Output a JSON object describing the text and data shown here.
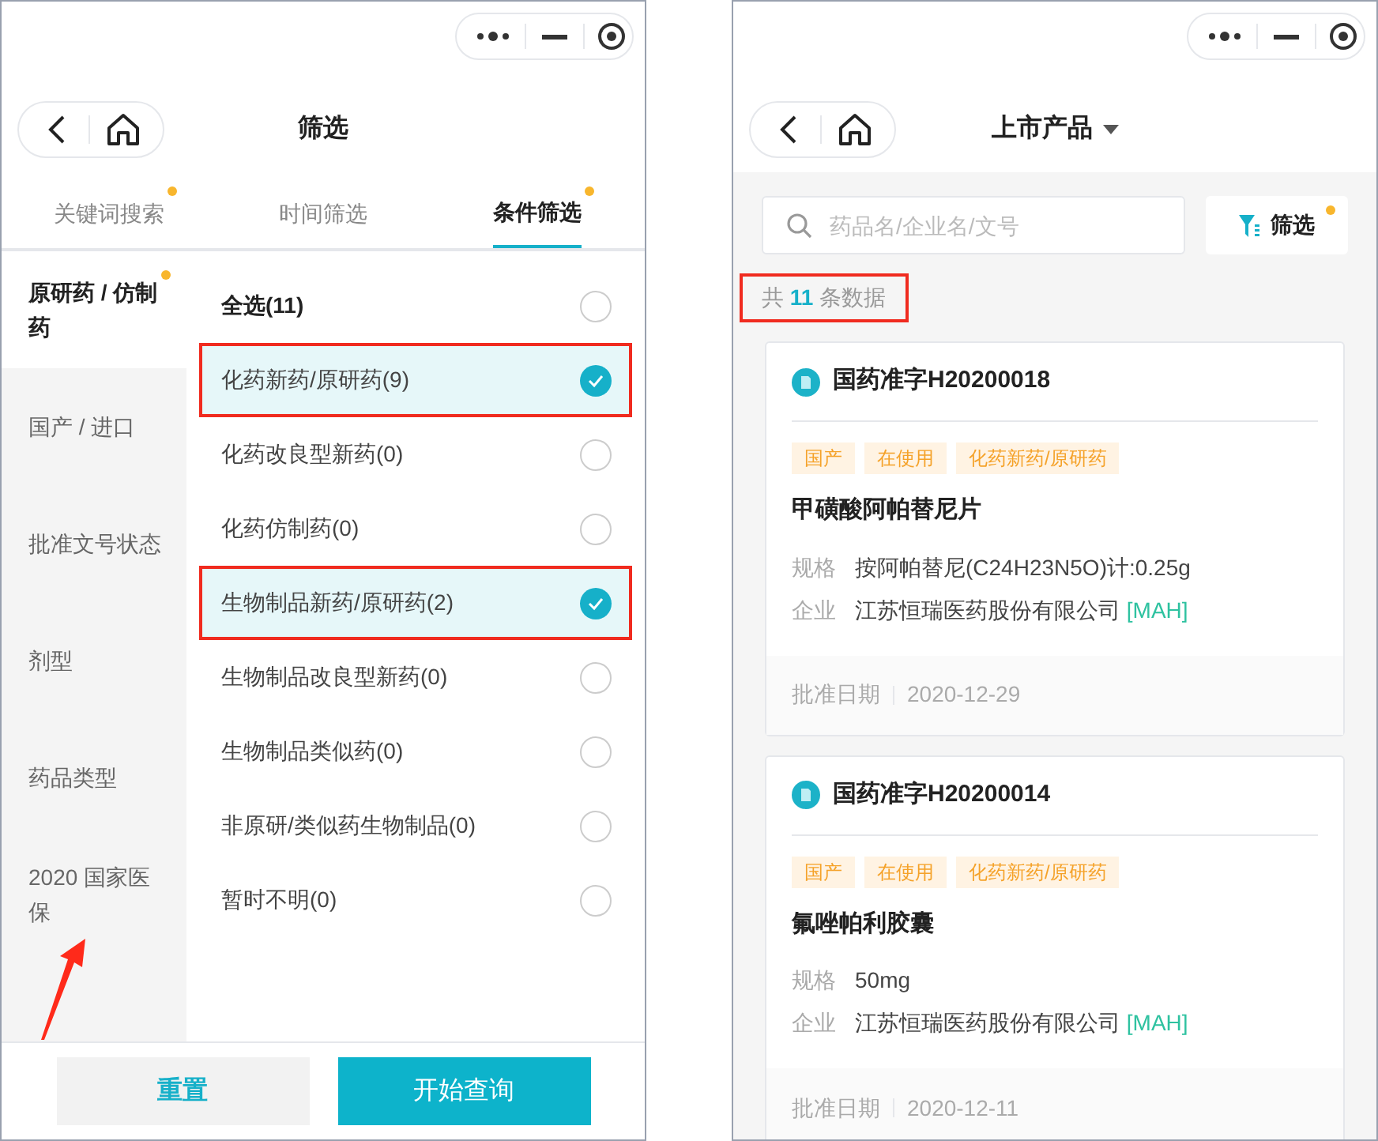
{
  "left_screen": {
    "title": "筛选",
    "tabs": [
      {
        "label": "关键词搜索",
        "selected": false,
        "dot": true
      },
      {
        "label": "时间筛选",
        "selected": false,
        "dot": false
      },
      {
        "label": "条件筛选",
        "selected": true,
        "dot": true
      }
    ],
    "sidebar": {
      "items": [
        {
          "label": "原研药 / 仿制药",
          "selected": true,
          "dot": true,
          "arrow": false
        },
        {
          "label": "国产 / 进口",
          "selected": false,
          "dot": false,
          "arrow": false
        },
        {
          "label": "批准文号状态",
          "selected": false,
          "dot": false,
          "arrow": false
        },
        {
          "label": "剂型",
          "selected": false,
          "dot": false,
          "arrow": false
        },
        {
          "label": "药品类型",
          "selected": false,
          "dot": false,
          "arrow": false
        },
        {
          "label": "2020 国家医保",
          "selected": false,
          "dot": false,
          "arrow": true
        }
      ]
    },
    "options": [
      {
        "label": "全选(11)",
        "kind": "all",
        "checked": false,
        "highlighted": false
      },
      {
        "label": "化药新药/原研药(9)",
        "kind": "option",
        "checked": true,
        "highlighted": true
      },
      {
        "label": "化药改良型新药(0)",
        "kind": "option",
        "checked": false,
        "highlighted": false
      },
      {
        "label": "化药仿制药(0)",
        "kind": "option",
        "checked": false,
        "highlighted": false
      },
      {
        "label": "生物制品新药/原研药(2)",
        "kind": "option",
        "checked": true,
        "highlighted": true
      },
      {
        "label": "生物制品改良型新药(0)",
        "kind": "option",
        "checked": false,
        "highlighted": false
      },
      {
        "label": "生物制品类似药(0)",
        "kind": "option",
        "checked": false,
        "highlighted": false
      },
      {
        "label": "非原研/类似药生物制品(0)",
        "kind": "option",
        "checked": false,
        "highlighted": false
      },
      {
        "label": "暂时不明(0)",
        "kind": "option",
        "checked": false,
        "highlighted": false
      }
    ],
    "buttons": [
      {
        "label": "重置",
        "kind": "secondary"
      },
      {
        "label": "开始查询",
        "kind": "primary"
      }
    ]
  },
  "right_screen": {
    "title": "上市产品",
    "search": {
      "placeholder": "药品名/企业名/文号"
    },
    "filter_button": {
      "label": "筛选",
      "dot": true
    },
    "count": {
      "prefix": "共",
      "number": "11",
      "suffix": "条数据",
      "highlighted": true
    },
    "cards": [
      {
        "approval_no": "国药准字H20200018",
        "tags": [
          "国产",
          "在使用",
          "化药新药/原研药"
        ],
        "name": "甲磺酸阿帕替尼片",
        "spec_label": "规格",
        "spec": "按阿帕替尼(C24H23N5O)计:0.25g",
        "company_label": "企业",
        "company": "江苏恒瑞医药股份有限公司",
        "company_tag": "[MAH]",
        "date_label": "批准日期",
        "date": "2020-12-29"
      },
      {
        "approval_no": "国药准字H20200014",
        "tags": [
          "国产",
          "在使用",
          "化药新药/原研药"
        ],
        "name": "氟唑帕利胶囊",
        "spec_label": "规格",
        "spec": "50mg",
        "company_label": "企业",
        "company": "江苏恒瑞医药股份有限公司",
        "company_tag": "[MAH]",
        "date_label": "批准日期",
        "date": "2020-12-11"
      }
    ]
  }
}
